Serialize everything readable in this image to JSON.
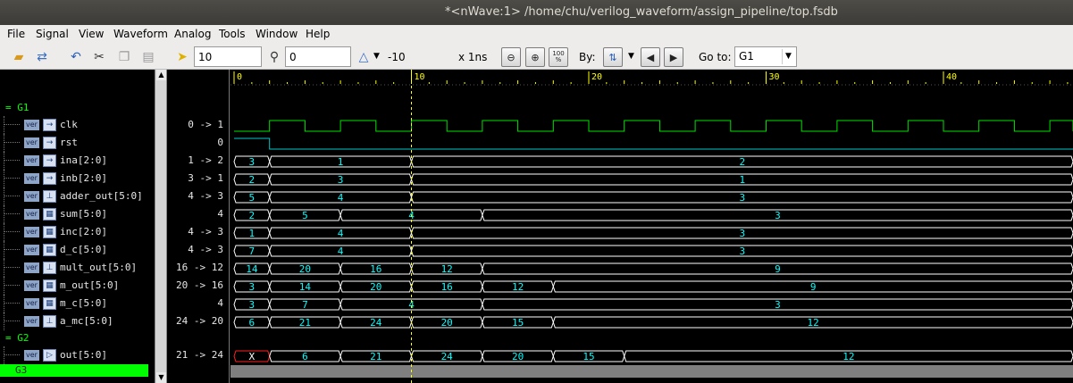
{
  "window": {
    "title": "*<nWave:1> /home/chu/verilog_waveform/assign_pipeline/top.fsdb"
  },
  "menu": [
    "File",
    "Signal",
    "View",
    "Waveform",
    "Analog",
    "Tools",
    "Window",
    "Help"
  ],
  "toolbar": {
    "cursor_time": "10",
    "marker_time": "0",
    "delta": "-10",
    "time_unit": "x 1ns",
    "zoom_fit_label": "100\n%",
    "by_label": "By:",
    "goto_label": "Go to:",
    "goto_value": "G1"
  },
  "ruler": {
    "ticks": [
      "0",
      "10",
      "20",
      "30",
      "40"
    ]
  },
  "groups": {
    "g1": "G1",
    "g2": "G2",
    "g3": "G3"
  },
  "signals": [
    {
      "name": "clk",
      "value": "0 -> 1",
      "icon": "input-port-icon",
      "glyph": "→",
      "type": "clock"
    },
    {
      "name": "rst",
      "value": "0",
      "icon": "input-port-icon",
      "glyph": "→",
      "type": "reset"
    },
    {
      "name": "ina[2:0]",
      "value": "1 -> 2",
      "icon": "input-port-icon",
      "glyph": "→",
      "type": "bus",
      "segments": [
        {
          "t": 0,
          "v": "3"
        },
        {
          "t": 2,
          "v": "1"
        },
        {
          "t": 10,
          "v": "2"
        }
      ]
    },
    {
      "name": "inb[2:0]",
      "value": "3 -> 1",
      "icon": "input-port-icon",
      "glyph": "→",
      "type": "bus",
      "segments": [
        {
          "t": 0,
          "v": "2"
        },
        {
          "t": 2,
          "v": "3"
        },
        {
          "t": 10,
          "v": "1"
        }
      ]
    },
    {
      "name": "adder_out[5:0]",
      "value": "4 -> 3",
      "icon": "net-icon",
      "glyph": "⊥",
      "type": "bus",
      "segments": [
        {
          "t": 0,
          "v": "5"
        },
        {
          "t": 2,
          "v": "4"
        },
        {
          "t": 10,
          "v": "3"
        }
      ]
    },
    {
      "name": "sum[5:0]",
      "value": "4",
      "icon": "register-icon",
      "glyph": "▦",
      "type": "bus",
      "segments": [
        {
          "t": 0,
          "v": "2"
        },
        {
          "t": 2,
          "v": "5"
        },
        {
          "t": 6,
          "v": "4"
        },
        {
          "t": 14,
          "v": "3"
        }
      ]
    },
    {
      "name": "inc[2:0]",
      "value": "4 -> 3",
      "icon": "register-icon",
      "glyph": "▦",
      "type": "bus",
      "segments": [
        {
          "t": 0,
          "v": "1"
        },
        {
          "t": 2,
          "v": "4"
        },
        {
          "t": 10,
          "v": "3"
        }
      ]
    },
    {
      "name": "d_c[5:0]",
      "value": "4 -> 3",
      "icon": "register-icon",
      "glyph": "▦",
      "type": "bus",
      "segments": [
        {
          "t": 0,
          "v": "7"
        },
        {
          "t": 2,
          "v": "4"
        },
        {
          "t": 10,
          "v": "3"
        }
      ]
    },
    {
      "name": "mult_out[5:0]",
      "value": "16 -> 12",
      "icon": "net-icon",
      "glyph": "⊥",
      "type": "bus",
      "segments": [
        {
          "t": 0,
          "v": "14"
        },
        {
          "t": 2,
          "v": "20"
        },
        {
          "t": 6,
          "v": "16"
        },
        {
          "t": 10,
          "v": "12"
        },
        {
          "t": 14,
          "v": "9"
        }
      ]
    },
    {
      "name": "m_out[5:0]",
      "value": "20 -> 16",
      "icon": "register-icon",
      "glyph": "▦",
      "type": "bus",
      "segments": [
        {
          "t": 0,
          "v": "3"
        },
        {
          "t": 2,
          "v": "14"
        },
        {
          "t": 6,
          "v": "20"
        },
        {
          "t": 10,
          "v": "16"
        },
        {
          "t": 14,
          "v": "12"
        },
        {
          "t": 18,
          "v": "9"
        }
      ]
    },
    {
      "name": "m_c[5:0]",
      "value": "4",
      "icon": "register-icon",
      "glyph": "▦",
      "type": "bus",
      "segments": [
        {
          "t": 0,
          "v": "3"
        },
        {
          "t": 2,
          "v": "7"
        },
        {
          "t": 6,
          "v": "4"
        },
        {
          "t": 14,
          "v": "3"
        }
      ]
    },
    {
      "name": "a_mc[5:0]",
      "value": "24 -> 20",
      "icon": "net-icon",
      "glyph": "⊥",
      "type": "bus",
      "segments": [
        {
          "t": 0,
          "v": "6"
        },
        {
          "t": 2,
          "v": "21"
        },
        {
          "t": 6,
          "v": "24"
        },
        {
          "t": 10,
          "v": "20"
        },
        {
          "t": 14,
          "v": "15"
        },
        {
          "t": 18,
          "v": "12"
        }
      ]
    },
    {
      "name": "out[5:0]",
      "value": "21 -> 24",
      "icon": "output-port-icon",
      "glyph": "▷",
      "type": "bus",
      "segments": [
        {
          "t": 0,
          "v": "X"
        },
        {
          "t": 2,
          "v": "6"
        },
        {
          "t": 6,
          "v": "21"
        },
        {
          "t": 10,
          "v": "24"
        },
        {
          "t": 14,
          "v": "20"
        },
        {
          "t": 18,
          "v": "15"
        },
        {
          "t": 22,
          "v": "12"
        }
      ]
    }
  ],
  "time": {
    "start": 0,
    "end": 47.5,
    "cursor": 10,
    "clock_half_period": 2
  },
  "colors": {
    "clock": "#00e000",
    "reset": "#00c8c8",
    "bus": "#ffffff",
    "bus_text": "#00ffff",
    "unknown": "#ff2020",
    "cursor": "#ffff00",
    "ruler_text": "#ffff00",
    "group": "#00ff00"
  }
}
